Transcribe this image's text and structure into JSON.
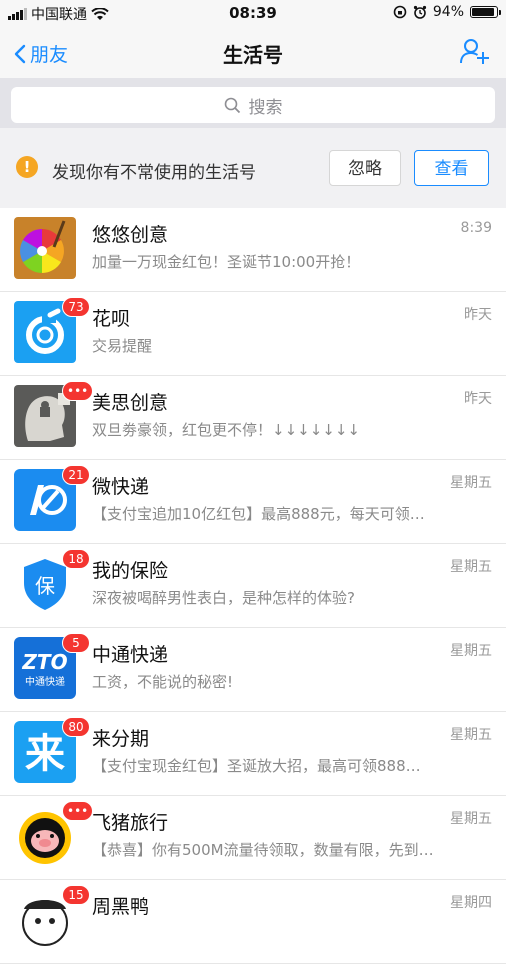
{
  "status": {
    "carrier": "中国联通",
    "time": "08:39",
    "battery": "94%",
    "battery_level": 0.94
  },
  "nav": {
    "back_label": "朋友",
    "title": "生活号"
  },
  "search": {
    "placeholder": "搜索"
  },
  "notice": {
    "text": "发现你有不常使用的生活号",
    "ignore_label": "忽略",
    "view_label": "查看"
  },
  "colors": {
    "accent": "#1a8cff",
    "badge": "#f43530",
    "warning": "#f5a623"
  },
  "list": [
    {
      "name": "悠悠创意",
      "message": "加量一万现金红包！圣诞节10:00开抢！",
      "time": "8:39",
      "badge": "",
      "icon": "colorwheel-icon"
    },
    {
      "name": "花呗",
      "message": "交易提醒",
      "time": "昨天",
      "badge": "73",
      "icon": "huabei-icon"
    },
    {
      "name": "美思创意",
      "message": "双旦劵豪领，红包更不停！↓↓↓↓↓↓↓",
      "time": "昨天",
      "badge": "•••",
      "icon": "puzzle-head-icon"
    },
    {
      "name": "微快递",
      "message": "【支付宝追加10亿红包】最高888元，每天可领…",
      "time": "星期五",
      "badge": "21",
      "icon": "kuaidi-icon"
    },
    {
      "name": "我的保险",
      "message": "深夜被喝醉男性表白，是种怎样的体验?",
      "time": "星期五",
      "badge": "18",
      "icon": "shield-icon"
    },
    {
      "name": "中通快递",
      "message": "工资，不能说的秘密!",
      "time": "星期五",
      "badge": "5",
      "icon": "zto-icon"
    },
    {
      "name": "来分期",
      "message": "【支付宝现金红包】圣诞放大招，最高可领888…",
      "time": "星期五",
      "badge": "80",
      "icon": "laifenqi-icon"
    },
    {
      "name": "飞猪旅行",
      "message": "【恭喜】你有500M流量待领取，数量有限，先到…",
      "time": "星期五",
      "badge": "•••",
      "icon": "pig-icon"
    },
    {
      "name": "周黑鸭",
      "message": "",
      "time": "星期四",
      "badge": "15",
      "icon": "duck-icon"
    }
  ]
}
